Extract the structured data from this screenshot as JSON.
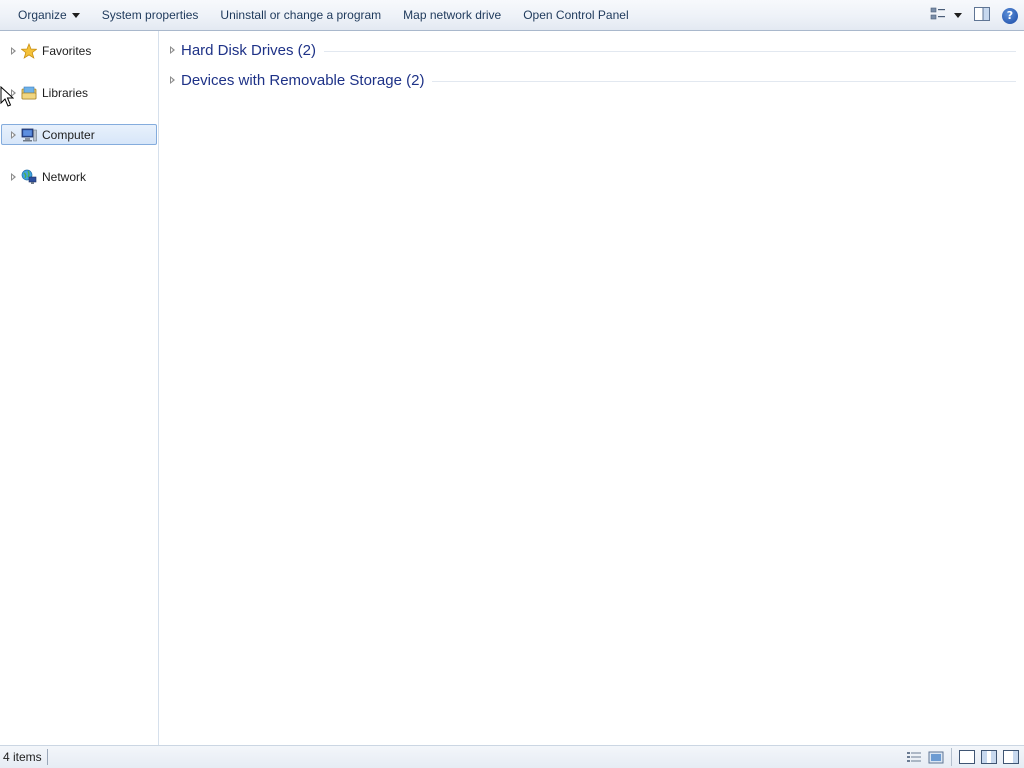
{
  "toolbar": {
    "organize_label": "Organize",
    "buttons": [
      "System properties",
      "Uninstall or change a program",
      "Map network drive",
      "Open Control Panel"
    ],
    "icons": [
      "change-view-icon",
      "preview-pane-icon",
      "help-icon"
    ],
    "help_glyph": "?"
  },
  "nav": {
    "items": [
      {
        "label": "Favorites",
        "icon": "star-icon",
        "selected": false
      },
      {
        "label": "Libraries",
        "icon": "libraries-icon",
        "selected": false
      },
      {
        "label": "Computer",
        "icon": "computer-icon",
        "selected": true
      },
      {
        "label": "Network",
        "icon": "network-icon",
        "selected": false
      }
    ]
  },
  "content": {
    "groups": [
      {
        "label": "Hard Disk Drives (2)"
      },
      {
        "label": "Devices with Removable Storage (2)"
      }
    ]
  },
  "status": {
    "item_count": "4 items",
    "icons": [
      "details-view-icon",
      "large-icons-view-icon",
      "layout-normal-icon",
      "layout-preview-icon",
      "layout-details-icon"
    ]
  },
  "colors": {
    "accent": "#1e3287",
    "selection": "#d7e6f9",
    "selection_border": "#84acdd"
  }
}
